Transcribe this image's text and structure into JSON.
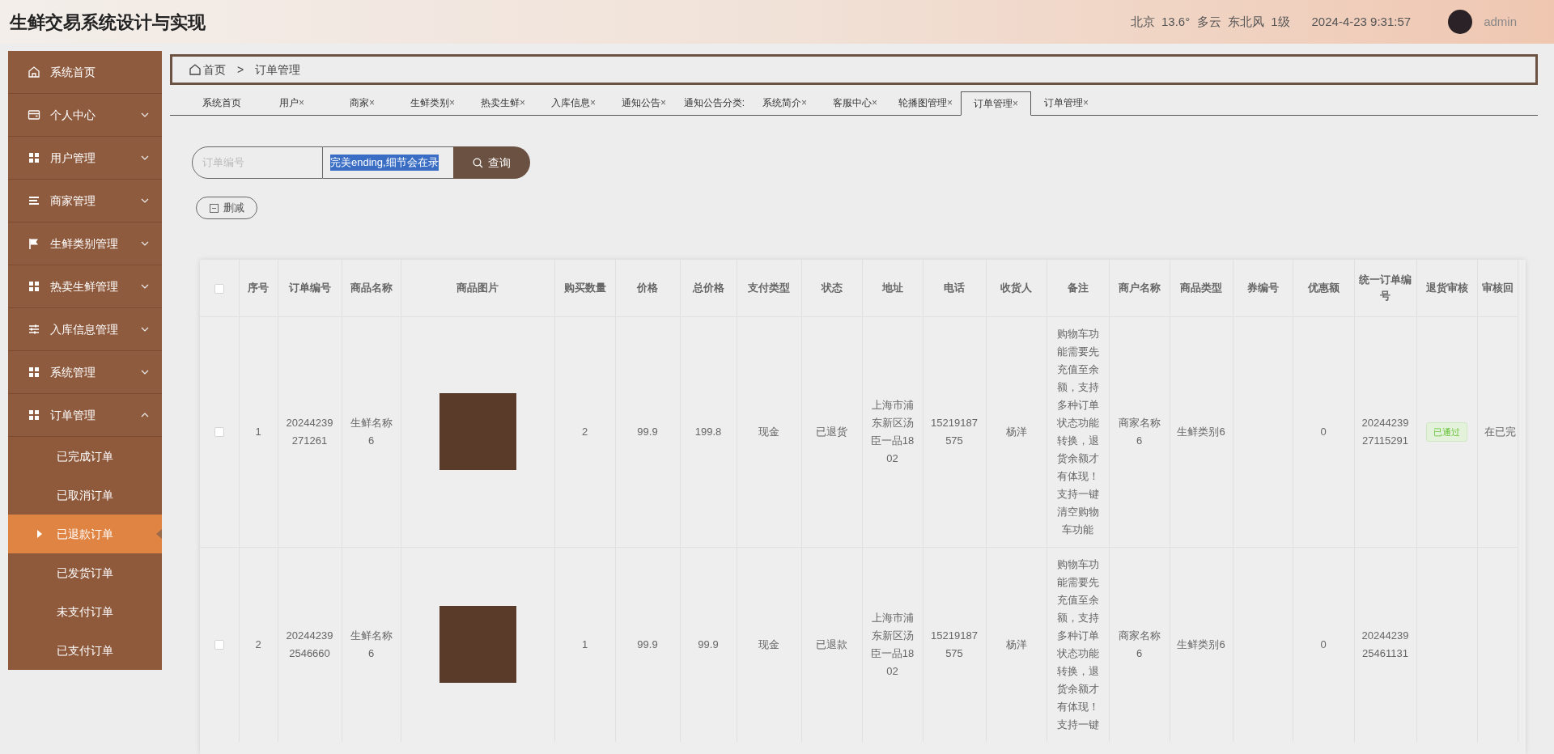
{
  "header": {
    "title": "生鲜交易系统设计与实现",
    "weather": "北京  13.6°  多云  东北风  1级",
    "datetime": "2024-4-23 9:31:57",
    "user": "admin"
  },
  "sidebar": {
    "items": [
      {
        "label": "系统首页",
        "kind": "home",
        "expandable": false,
        "expanded": false
      },
      {
        "label": "个人中心",
        "kind": "card",
        "expandable": true,
        "expanded": false
      },
      {
        "label": "用户管理",
        "kind": "grid",
        "expandable": true,
        "expanded": false
      },
      {
        "label": "商家管理",
        "kind": "list",
        "expandable": true,
        "expanded": false
      },
      {
        "label": "生鲜类别管理",
        "kind": "flag",
        "expandable": true,
        "expanded": false
      },
      {
        "label": "热卖生鲜管理",
        "kind": "grid",
        "expandable": true,
        "expanded": false
      },
      {
        "label": "入库信息管理",
        "kind": "sliders",
        "expandable": true,
        "expanded": false
      },
      {
        "label": "系统管理",
        "kind": "grid",
        "expandable": true,
        "expanded": false
      },
      {
        "label": "订单管理",
        "kind": "grid",
        "expandable": true,
        "expanded": true,
        "children": [
          {
            "label": "已完成订单",
            "selected": false
          },
          {
            "label": "已取消订单",
            "selected": false
          },
          {
            "label": "已退款订单",
            "selected": true
          },
          {
            "label": "已发货订单",
            "selected": false
          },
          {
            "label": "未支付订单",
            "selected": false
          },
          {
            "label": "已支付订单",
            "selected": false
          }
        ]
      }
    ]
  },
  "breadcrumb": [
    "首页",
    "订单管理"
  ],
  "breadcrumb_separator": ">",
  "tabs": [
    {
      "label": "系统首页",
      "closable": false,
      "selected": false
    },
    {
      "label": "用户",
      "closable": true,
      "selected": false
    },
    {
      "label": "商家",
      "closable": true,
      "selected": false
    },
    {
      "label": "生鲜类别",
      "closable": true,
      "selected": false
    },
    {
      "label": "热卖生鲜",
      "closable": true,
      "selected": false
    },
    {
      "label": "入库信息",
      "closable": true,
      "selected": false
    },
    {
      "label": "通知公告",
      "closable": true,
      "selected": false
    },
    {
      "label": "通知公告分类:",
      "closable": false,
      "selected": false
    },
    {
      "label": "系统简介",
      "closable": true,
      "selected": false
    },
    {
      "label": "客服中心",
      "closable": true,
      "selected": false
    },
    {
      "label": "轮播图管理",
      "closable": true,
      "selected": false
    },
    {
      "label": "订单管理",
      "closable": true,
      "selected": true
    },
    {
      "label": "订单管理",
      "closable": true,
      "selected": false
    }
  ],
  "tab_close": "×",
  "search": {
    "placeholder": "订单编号",
    "value": "完美ending,细节会在录",
    "button": "查询"
  },
  "delete_button": "删减",
  "table": {
    "select_all_checked": false,
    "columns": [
      {
        "label": "序号",
        "kind": "text"
      },
      {
        "label": "订单编号",
        "kind": "text"
      },
      {
        "label": "商品名称",
        "kind": "text"
      },
      {
        "label": "商品图片",
        "kind": "image"
      },
      {
        "label": "购买数量",
        "kind": "text"
      },
      {
        "label": "价格",
        "kind": "text"
      },
      {
        "label": "总价格",
        "kind": "text"
      },
      {
        "label": "支付类型",
        "kind": "text"
      },
      {
        "label": "状态",
        "kind": "text"
      },
      {
        "label": "地址",
        "kind": "text"
      },
      {
        "label": "电话",
        "kind": "text"
      },
      {
        "label": "收货人",
        "kind": "text"
      },
      {
        "label": "备注",
        "kind": "text"
      },
      {
        "label": "商户名称",
        "kind": "text"
      },
      {
        "label": "商品类型",
        "kind": "text"
      },
      {
        "label": "券编号",
        "kind": "text"
      },
      {
        "label": "优惠额",
        "kind": "text"
      },
      {
        "label": "统一订单编号",
        "kind": "text"
      },
      {
        "label": "退货审核",
        "kind": "badge"
      },
      {
        "label": "审核回",
        "kind": "text"
      }
    ],
    "rows": [
      {
        "checked": false,
        "photo": true,
        "cells": [
          "1",
          "20244239271261",
          "生鲜名称6",
          null,
          "2",
          "99.9",
          "199.8",
          "现金",
          "已退货",
          "上海市浦东新区汤臣一品1802",
          "15219187575",
          "杨洋",
          "购物车功能需要先充值至余额，支持多种订单状态功能转换，退货余额才有体现！支持一键清空购物车功能",
          "商家名称6",
          "生鲜类别6",
          null,
          "0",
          "2024423927115291",
          "已通过",
          "在已完"
        ]
      },
      {
        "checked": false,
        "photo": true,
        "cells": [
          "2",
          "202442392546660",
          "生鲜名称6",
          null,
          "1",
          "99.9",
          "99.9",
          "现金",
          "已退款",
          "上海市浦东新区汤臣一品1802",
          "15219187575",
          "杨洋",
          "购物车功能需要先充值至余额，支持多种订单状态功能转换，退货余额才有体现！支持一键",
          "商家名称6",
          "生鲜类别6",
          null,
          "0",
          "2024423925461131",
          null,
          null
        ]
      }
    ]
  }
}
